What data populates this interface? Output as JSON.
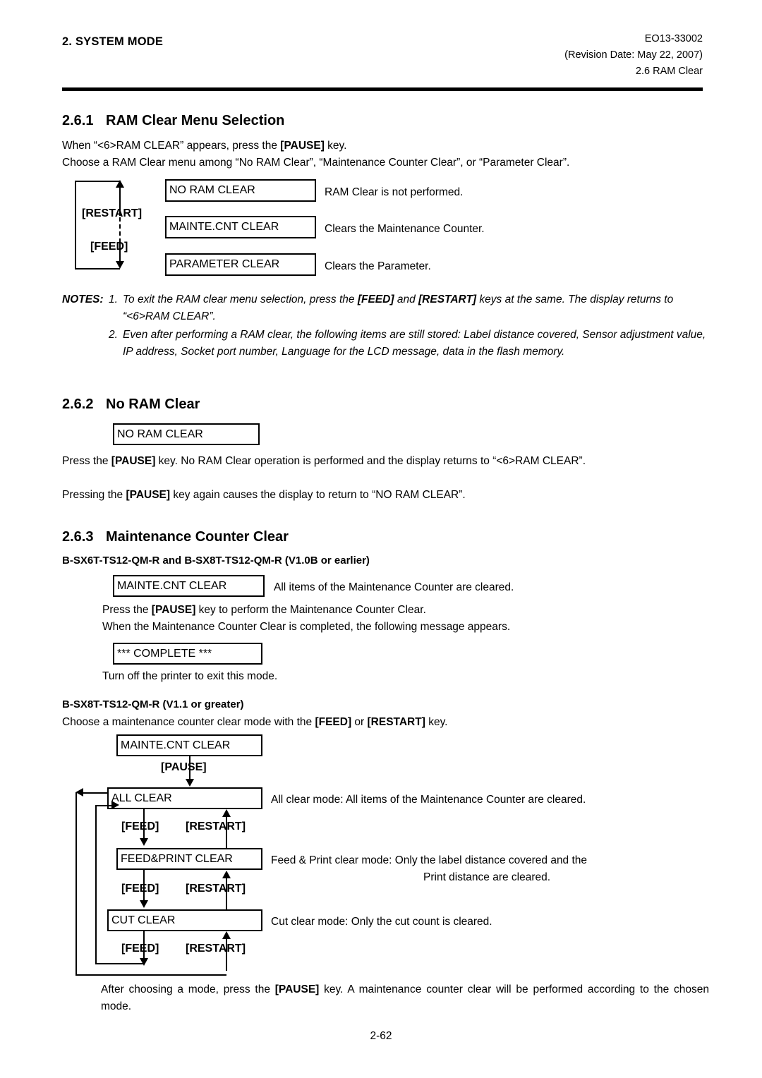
{
  "header": {
    "left_title": "2. SYSTEM MODE",
    "doc_code": "EO13-33002",
    "revision": "(Revision Date: May 22, 2007)",
    "section_ref": "2.6 RAM Clear"
  },
  "section_261": {
    "number": "2.6.1",
    "title": "RAM Clear Menu Selection",
    "para1_pre": "When “<6>RAM CLEAR” appears, press the ",
    "para1_key": "[PAUSE]",
    "para1_post": " key.",
    "para2": "Choose a RAM Clear menu among “No RAM Clear”, “Maintenance Counter Clear”, or “Parameter Clear”.",
    "diagram": {
      "key_up": "[RESTART]",
      "key_down": "[FEED]",
      "rows": [
        {
          "box": "NO RAM CLEAR",
          "desc": "RAM Clear is not performed."
        },
        {
          "box": "MAINTE.CNT CLEAR",
          "desc": "Clears the Maintenance Counter."
        },
        {
          "box": "PARAMETER CLEAR",
          "desc": "Clears the Parameter."
        }
      ]
    }
  },
  "notes": {
    "label": "NOTES:",
    "items": [
      {
        "num": "1.",
        "seg1": "To exit the RAM clear menu selection, press the ",
        "key1": "[FEED]",
        "seg2": " and ",
        "key2": "[RESTART]",
        "seg3": " keys at the same.  The display returns to “<6>RAM CLEAR”."
      },
      {
        "num": "2.",
        "seg1": "Even after performing a RAM clear, the following items are still stored: Label distance covered, Sensor adjustment value, IP address, Socket port number, Language for the LCD message, data in the flash memory.",
        "key1": "",
        "seg2": "",
        "key2": "",
        "seg3": ""
      }
    ]
  },
  "section_262": {
    "number": "2.6.2",
    "title": "No RAM Clear",
    "box": "NO RAM CLEAR",
    "para1_pre": "Press the ",
    "para1_key": "[PAUSE]",
    "para1_post": " key.  No RAM Clear operation is performed and the display returns to “<6>RAM CLEAR”.",
    "para2_pre": "Pressing the ",
    "para2_key": "[PAUSE]",
    "para2_post": " key again causes the display to return to “NO RAM CLEAR”."
  },
  "section_263": {
    "number": "2.6.3",
    "title": "Maintenance Counter Clear",
    "sub1_title": "B-SX6T-TS12-QM-R and B-SX8T-TS12-QM-R (V1.0B or earlier)",
    "sub1_box": "MAINTE.CNT CLEAR",
    "sub1_box_desc": "All items of the Maintenance Counter are cleared.",
    "sub1_line1_pre": "Press the ",
    "sub1_line1_key": "[PAUSE]",
    "sub1_line1_post": " key to perform the Maintenance Counter Clear.",
    "sub1_line2": "When the Maintenance Counter Clear is completed, the following message appears.",
    "sub1_box2": "*** COMPLETE ***",
    "sub1_line3": "Turn off the printer to exit this mode.",
    "sub2_title": "B-SX8T-TS12-QM-R (V1.1 or greater)",
    "sub2_line1_pre": "Choose a maintenance counter clear mode with the ",
    "sub2_line1_key1": "[FEED]",
    "sub2_line1_mid": " or ",
    "sub2_line1_key2": "[RESTART]",
    "sub2_line1_post": " key.",
    "flow": {
      "box_top": "MAINTE.CNT CLEAR",
      "key_pause": "[PAUSE]",
      "box_all": "ALL CLEAR",
      "box_feedprint": "FEED&PRINT CLEAR",
      "box_cut": "CUT CLEAR",
      "key_feed": "[FEED]",
      "key_restart": "[RESTART]",
      "desc_all": "All clear mode:  All items of the Maintenance Counter are cleared.",
      "desc_feedprint_1": "Feed & Print clear mode:   Only the label distance covered and the",
      "desc_feedprint_2": "Print distance are cleared.",
      "desc_cut": "Cut clear mode:  Only the cut count is cleared."
    },
    "closing_pre": "After choosing a mode, press the ",
    "closing_key": "[PAUSE]",
    "closing_post": " key.  A maintenance counter clear will be performed according to the chosen mode."
  },
  "page_number": "2-62"
}
